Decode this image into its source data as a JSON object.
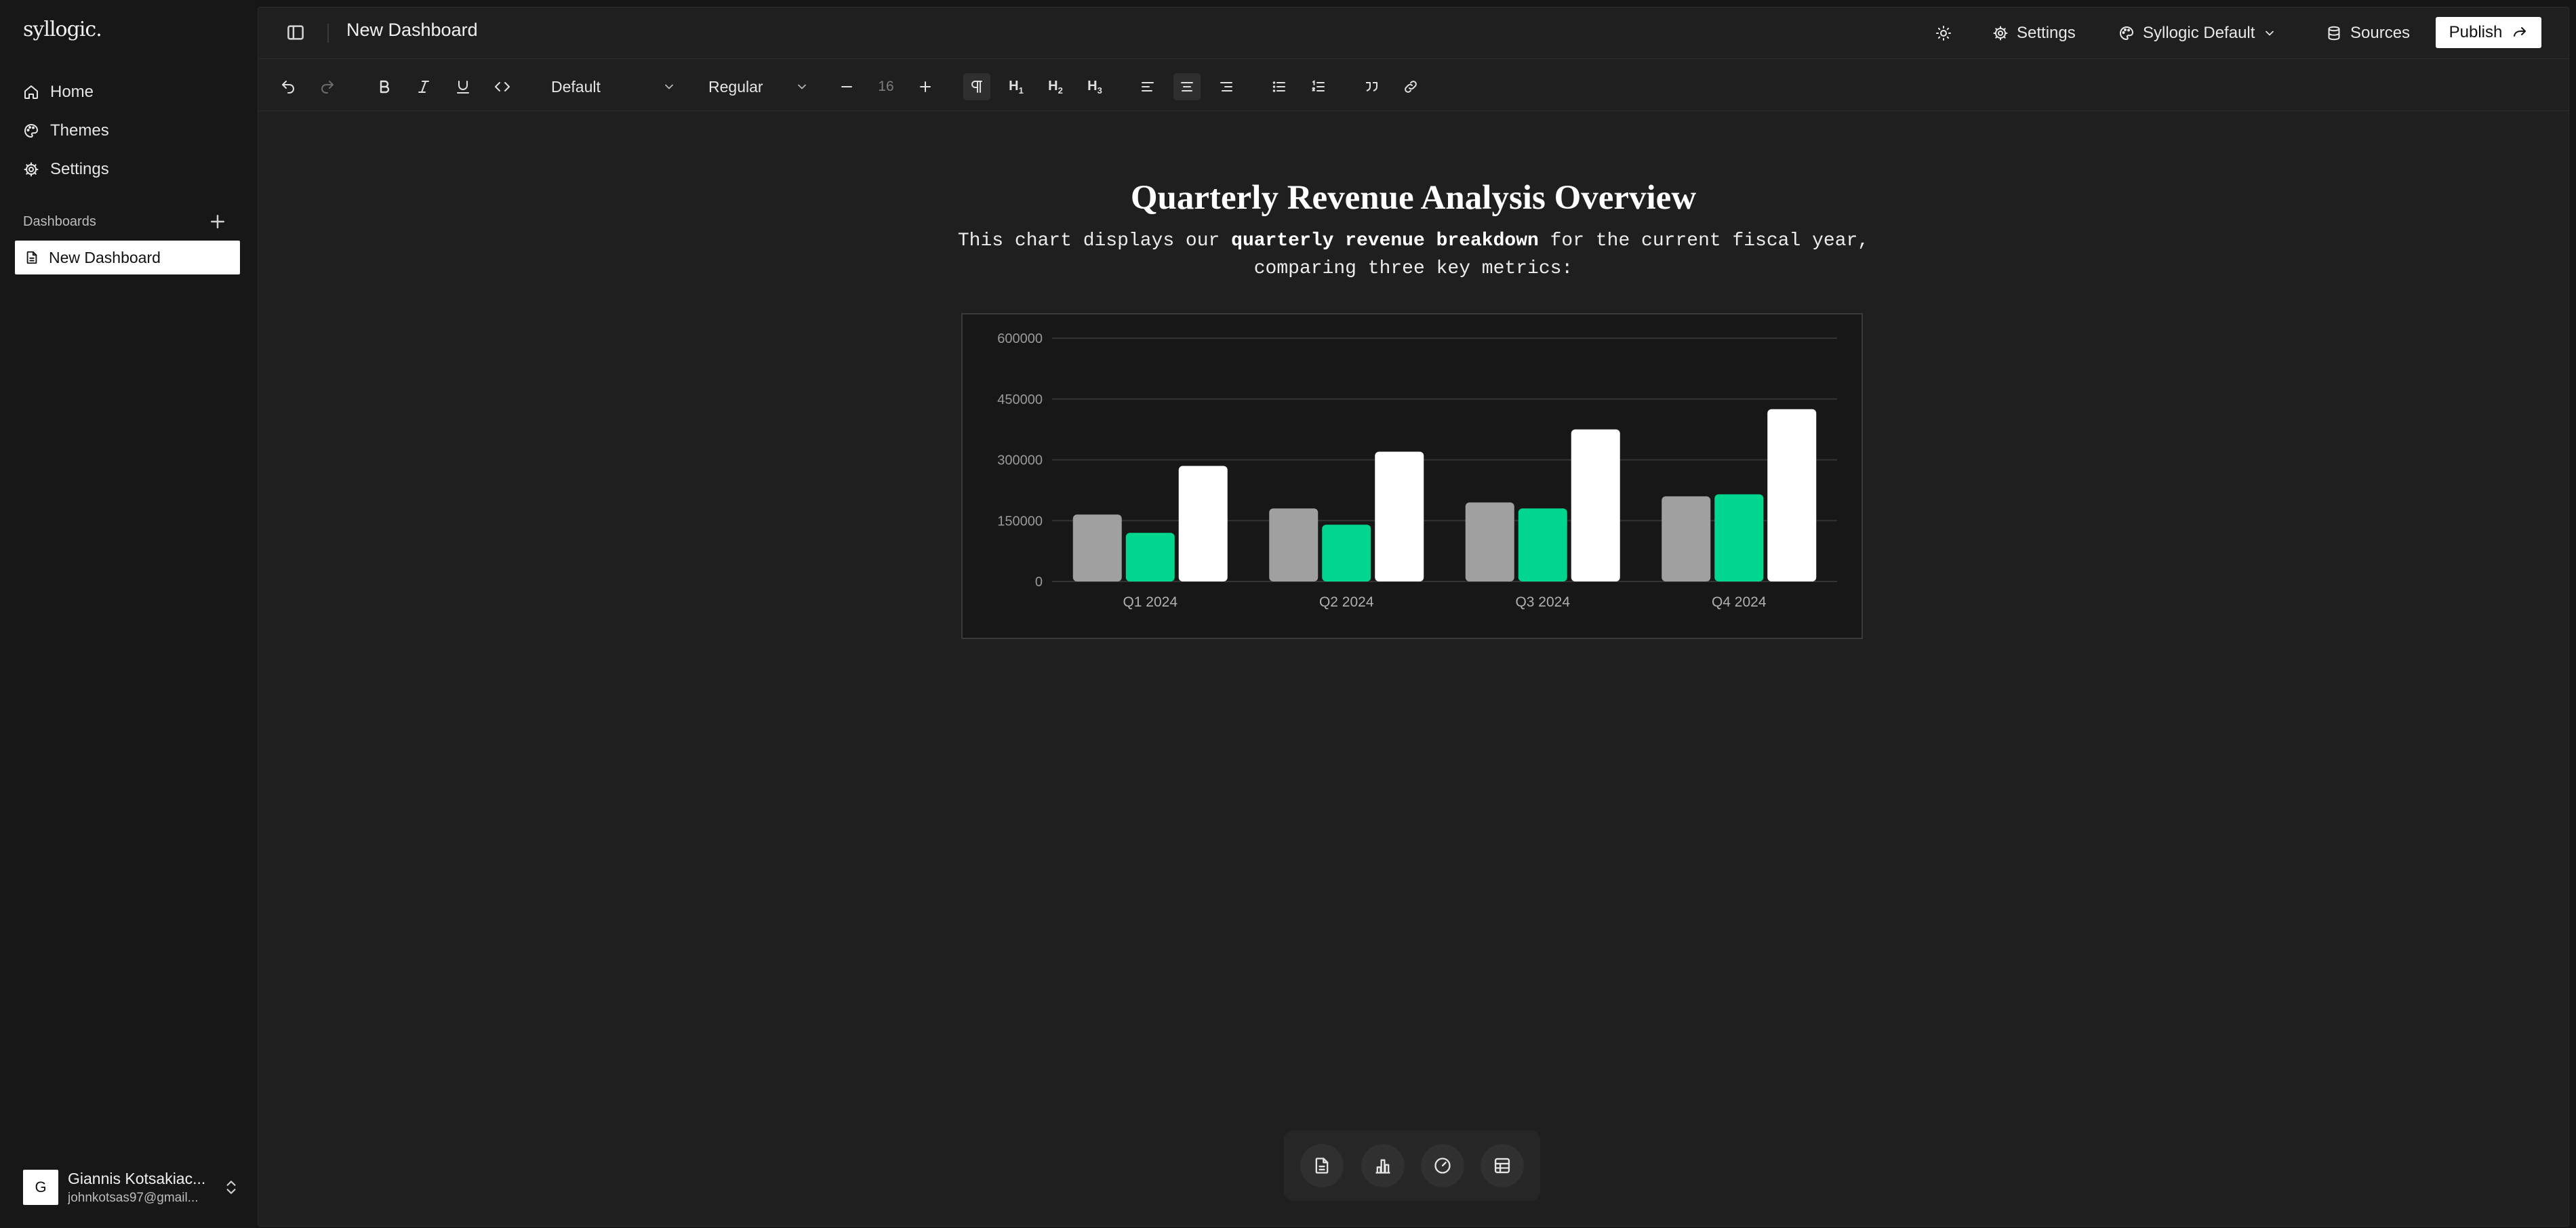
{
  "sidebar": {
    "logo": "syllogic.",
    "nav": [
      {
        "label": "Home",
        "icon": "home-icon"
      },
      {
        "label": "Themes",
        "icon": "palette-icon"
      },
      {
        "label": "Settings",
        "icon": "gear-icon"
      }
    ],
    "section_label": "Dashboards",
    "dashboards": [
      {
        "label": "New Dashboard",
        "icon": "document-icon",
        "active": true
      }
    ],
    "user": {
      "initial": "G",
      "name": "Giannis Kotsakiac...",
      "email": "johnkotsas97@gmail..."
    }
  },
  "header": {
    "title": "New Dashboard",
    "settings_label": "Settings",
    "theme_label": "Syllogic Default",
    "sources_label": "Sources",
    "publish_label": "Publish"
  },
  "toolbar": {
    "font_family": "Default",
    "font_weight": "Regular",
    "font_size": "16",
    "h1": "H1",
    "h2": "H2",
    "h3": "H3"
  },
  "document": {
    "heading": "Quarterly Revenue Analysis Overview",
    "para_before": "This chart displays our ",
    "para_bold": "quarterly revenue breakdown",
    "para_after": " for the current fiscal year, comparing three key metrics:"
  },
  "colors": {
    "accent": "#00d68f",
    "series_gray": "#a0a0a0",
    "series_white": "#ffffff",
    "background": "#1f1f1f"
  },
  "chart_data": {
    "type": "bar",
    "categories": [
      "Q1 2024",
      "Q2 2024",
      "Q3 2024",
      "Q4 2024"
    ],
    "series": [
      {
        "values": [
          165000,
          180000,
          195000,
          210000
        ],
        "color": "#a0a0a0"
      },
      {
        "values": [
          120000,
          140000,
          180000,
          215000
        ],
        "color": "#00d68f"
      },
      {
        "values": [
          285000,
          320000,
          375000,
          425000
        ],
        "color": "#ffffff"
      }
    ],
    "yticks": [
      0,
      150000,
      300000,
      450000,
      600000
    ],
    "ylim": [
      0,
      600000
    ],
    "grid": true,
    "legend": "none"
  }
}
